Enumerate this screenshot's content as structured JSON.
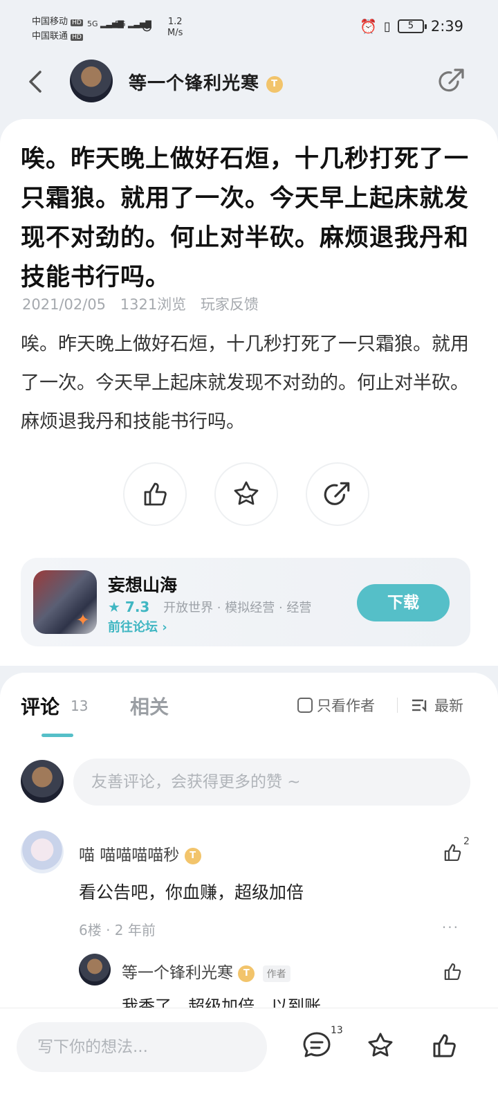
{
  "status_bar": {
    "carrier1": "中国移动",
    "carrier2": "中国联通",
    "hd": "HD",
    "sig1": "5G",
    "sig2": "5G",
    "net_speed": "1.2",
    "net_unit": "M/s",
    "battery": "5",
    "time": "2:39"
  },
  "header": {
    "author_name": "等一个锋利光寒",
    "level_badge": "T"
  },
  "post": {
    "title": "唉。昨天晚上做好石烜，十几秒打死了一只霜狼。就用了一次。今天早上起床就发现不对劲的。何止对半砍。麻烦退我丹和技能书行吗。",
    "date": "2021/02/05",
    "views": "1321浏览",
    "category": "玩家反馈",
    "body": "唉。昨天晚上做好石烜，十几秒打死了一只霜狼。就用了一次。今天早上起床就发现不对劲的。何止对半砍。麻烦退我丹和技能书行吗。"
  },
  "game": {
    "name": "妄想山海",
    "score": "7.3",
    "tags": "开放世界 · 模拟经营 · 经营",
    "forum_link": "前往论坛 ›",
    "download_label": "下载"
  },
  "comments_section": {
    "tab_comments": "评论",
    "comment_count": "13",
    "tab_related": "相关",
    "only_author": "只看作者",
    "sort_label": "最新",
    "input_placeholder": "友善评论，会获得更多的赞 ~",
    "comment": {
      "name": "喵 喵喵喵喵秒",
      "badge": "T",
      "likes": "2",
      "text": "看公告吧，你血赚，超级加倍",
      "meta": "6楼 · 2 年前",
      "more": "···"
    },
    "reply": {
      "name": "等一个锋利光寒",
      "badge": "T",
      "author_tag": "作者",
      "text": "我香了。超级加倍。以到账。"
    }
  },
  "bottom_bar": {
    "placeholder": "写下你的想法...",
    "comment_count": "13"
  },
  "icons": {
    "back": "back-arrow-icon",
    "share": "share-icon",
    "like": "thumbs-up-icon",
    "favorite": "star-icon",
    "comment": "comment-bubble-icon"
  },
  "colors": {
    "accent": "#55bfc8",
    "badge": "#f2c46b"
  }
}
